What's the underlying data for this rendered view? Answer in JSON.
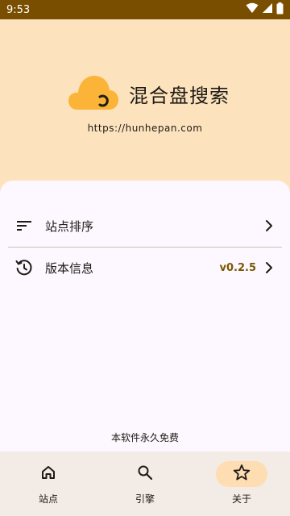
{
  "status_bar": {
    "time": "9:53"
  },
  "header": {
    "title": "混合盘搜索",
    "url": "https://hunhepan.com"
  },
  "menu": {
    "items": [
      {
        "label": "站点排序",
        "icon": "sort-icon"
      },
      {
        "label": "版本信息",
        "icon": "history-icon",
        "value": "v0.2.5"
      }
    ]
  },
  "footer_note": "本软件永久免费",
  "bottom_nav": {
    "items": [
      {
        "label": "站点",
        "icon": "home-icon"
      },
      {
        "label": "引擎",
        "icon": "search-icon"
      },
      {
        "label": "关于",
        "icon": "star-icon",
        "active": true
      }
    ]
  },
  "colors": {
    "status_bar": "#7a4e00",
    "hero_bg": "#fde3bd",
    "sheet_bg": "#fdf7ff",
    "accent": "#fbb437",
    "version_text": "#7a5a00",
    "nav_bg": "#f2ebe6",
    "nav_active_pill": "#ffddb3"
  }
}
